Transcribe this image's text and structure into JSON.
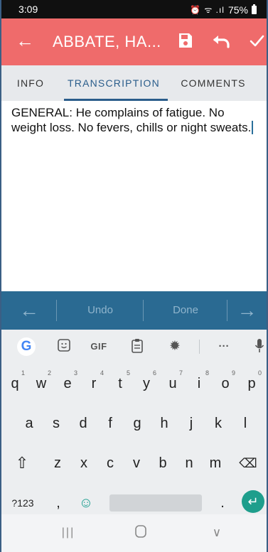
{
  "status_bar": {
    "time": "3:09",
    "icons": "⏰ ᯤ .ıl",
    "battery": "75%"
  },
  "app_bar": {
    "back_icon": "arrow-left-icon",
    "title": "ABBATE, HA...",
    "actions": [
      "save-icon",
      "undo-icon",
      "check-icon"
    ],
    "color": "#ef6b6b"
  },
  "tabs": [
    {
      "label": "INFO",
      "active": false
    },
    {
      "label": "TRANSCRIPTION",
      "active": true
    },
    {
      "label": "COMMENTS",
      "active": false
    }
  ],
  "editor": {
    "text": "GENERAL: He complains of fatigue. No weight loss. No fevers, chills or night sweats."
  },
  "suggestion_bar": {
    "left_arrow": "←",
    "undo_label": "Undo",
    "done_label": "Done",
    "right_arrow": "→",
    "color": "#2a6a92"
  },
  "keyboard": {
    "toolbar": {
      "google": "G",
      "sticker": "sticker-icon",
      "gif": "GIF",
      "clipboard": "clipboard-icon",
      "settings": "settings-icon",
      "more": "···",
      "mic": "mic-icon"
    },
    "row1": [
      {
        "key": "q",
        "hint": "1"
      },
      {
        "key": "w",
        "hint": "2"
      },
      {
        "key": "e",
        "hint": "3"
      },
      {
        "key": "r",
        "hint": "4"
      },
      {
        "key": "t",
        "hint": "5"
      },
      {
        "key": "y",
        "hint": "6"
      },
      {
        "key": "u",
        "hint": "7"
      },
      {
        "key": "i",
        "hint": "8"
      },
      {
        "key": "o",
        "hint": "9"
      },
      {
        "key": "p",
        "hint": "0"
      }
    ],
    "row2": [
      "a",
      "s",
      "d",
      "f",
      "g",
      "h",
      "j",
      "k",
      "l"
    ],
    "row3": [
      "z",
      "x",
      "c",
      "v",
      "b",
      "n",
      "m"
    ],
    "shift": "⇧",
    "backspace": "⌫",
    "symbols": "?123",
    "comma": ",",
    "emoji": "☺",
    "period": ".",
    "enter": "↵",
    "enter_color": "#1e9e8c"
  },
  "nav_bar": {
    "recents": "|||",
    "home": "home-icon",
    "back": "∨"
  }
}
